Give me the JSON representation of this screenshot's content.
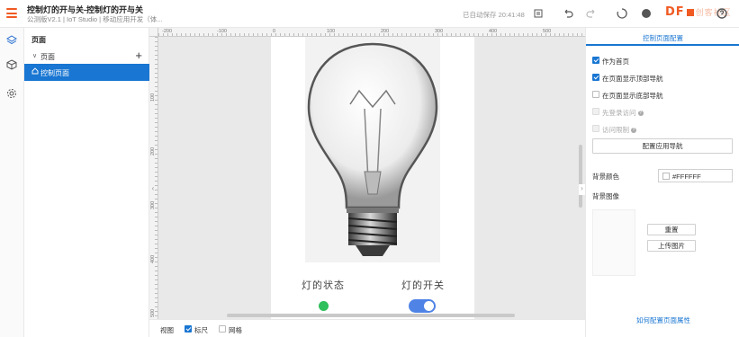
{
  "header": {
    "title": "控制灯的开与关-控制灯的开与关",
    "subtitle": "公测版V2.1 | IoT Studio | 移动应用开发（体...",
    "autosave": "已自动保存 20:41:48",
    "logo_text": "DF",
    "logo_ghost_text": "创客社区"
  },
  "left_panel": {
    "heading": "页面",
    "group_label": "页面",
    "add_symbol": "+",
    "selected_page": "控制页面"
  },
  "canvas": {
    "ruler_h_ticks": [
      "-200",
      "-100",
      "0",
      "100",
      "200",
      "300",
      "400",
      "500"
    ],
    "ruler_v_ticks": [
      "100",
      "200",
      "300",
      "400",
      "500"
    ],
    "status_label": "灯的状态",
    "switch_label": "灯的开关",
    "status_color": "#2fbf5b",
    "switch_on": true,
    "switch_color": "#4f83e6"
  },
  "bottom_bar": {
    "view_label": "视图",
    "ruler_label": "标尺",
    "ruler_checked": true,
    "grid_label": "网格",
    "grid_checked": false
  },
  "right_panel": {
    "tab_label": "控制页面配置",
    "opt_homepage": "作为首页",
    "opt_top_nav": "在页面显示顶部导航",
    "opt_bottom_nav": "在页面显示底部导航",
    "opt_login": "先登录访问",
    "opt_access_limit": "访问限制",
    "config_nav_button": "配置应用导航",
    "bg_color_label": "背景颜色",
    "bg_color_value": "#FFFFFF",
    "bg_image_label": "背景图像",
    "reset_button": "重置",
    "upload_button": "上传图片",
    "help_link": "如何配置页面属性"
  },
  "accent_color": "#1976d2",
  "brand_color": "#f05a22"
}
